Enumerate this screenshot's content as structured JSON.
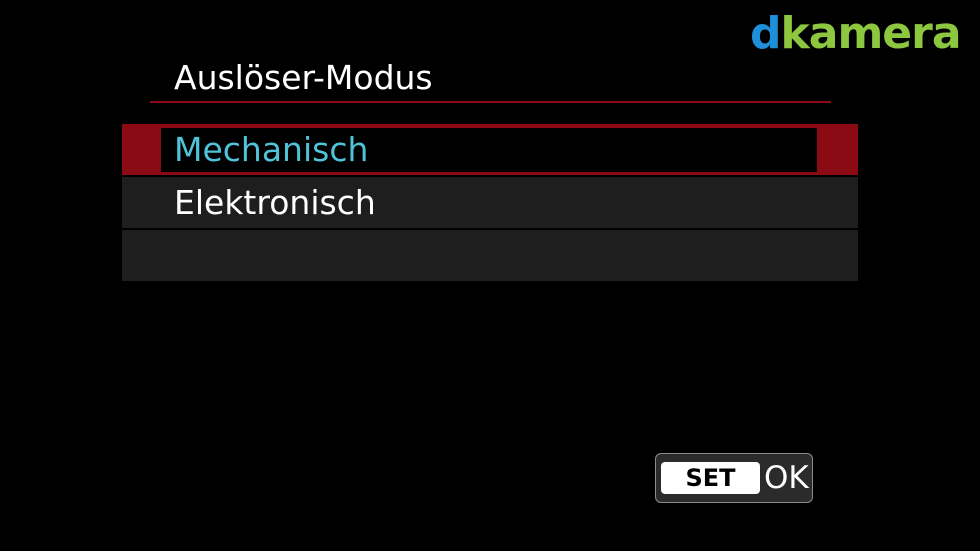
{
  "watermark": {
    "d": "d",
    "rest": "kamera"
  },
  "menu": {
    "title": "Auslöser-Modus",
    "options": [
      {
        "label": "Mechanisch",
        "selected": true
      },
      {
        "label": "Elektronisch",
        "selected": false
      }
    ]
  },
  "footer": {
    "set_key": "SET",
    "ok_label": "OK"
  },
  "colors": {
    "accent_red": "#8b0a14",
    "selected_text": "#4fc3d8",
    "row_bg": "#1e1e1e"
  }
}
